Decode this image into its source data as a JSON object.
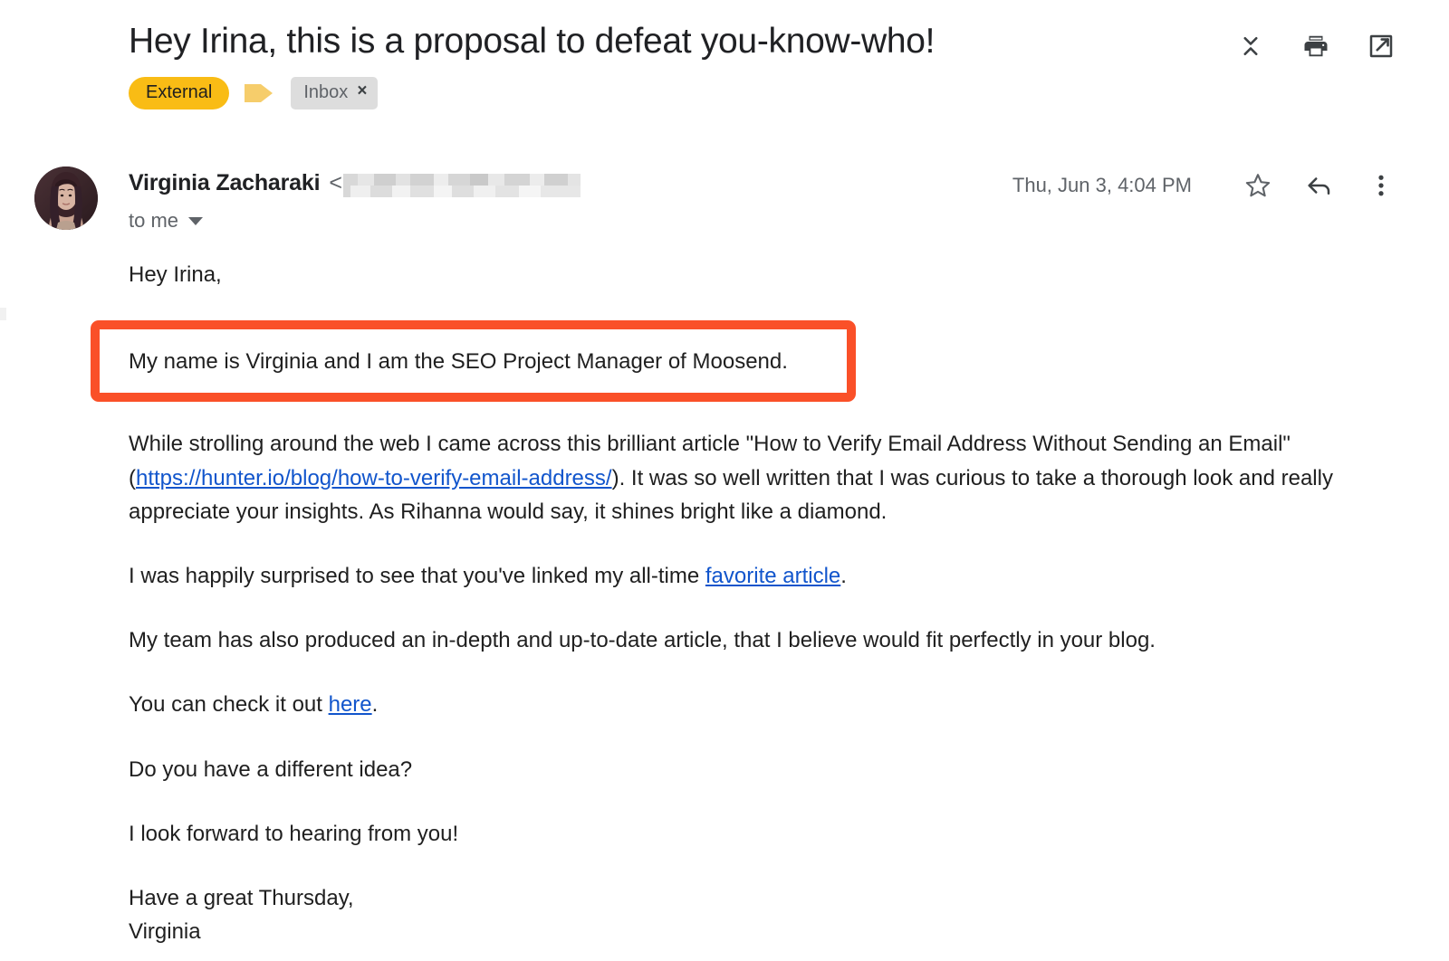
{
  "header": {
    "subject": "Hey Irina, this is a proposal to defeat you-know-who!",
    "actions": [
      {
        "name": "collapse-all-icon",
        "label": "Collapse all"
      },
      {
        "name": "print-icon",
        "label": "Print all"
      },
      {
        "name": "open-in-new-window-icon",
        "label": "Open in new window"
      }
    ]
  },
  "labels": {
    "external_label": "External",
    "inbox_label": "Inbox",
    "remove_label": "×",
    "external_color": "#f9bc15",
    "arrow_color": "#f6cd6b",
    "inbox_color": "#dddddd"
  },
  "sender": {
    "name": "Virginia Zacharaki",
    "angle_open": "<",
    "email_redacted": "",
    "recipients": "to me",
    "timestamp": "Thu, Jun 3, 4:04 PM",
    "actions": [
      {
        "name": "star-icon",
        "label": "Star"
      },
      {
        "name": "reply-icon",
        "label": "Reply"
      },
      {
        "name": "more-options-icon",
        "label": "More"
      }
    ]
  },
  "body": {
    "greeting": "Hey Irina,",
    "highlight_text": "My name is Virginia and I am the SEO Project Manager of Moosend.",
    "highlight_color": "#fa5028",
    "para_article_1": "While strolling around the web I came across this brilliant article \"How to Verify Email Address Without Sending an Email\" (",
    "article_url": "https://hunter.io/blog/how-to-verify-email-address/",
    "para_article_2": "). It was so well written that I was curious to take a thorough look and really appreciate your insights. As Rihanna would say, it shines bright like a diamond.",
    "para_favorite_1": "I was happily surprised to see that you've linked my all-time ",
    "favorite_link": "favorite article",
    "para_favorite_2": ".",
    "para_team": "My team has also produced an in-depth and up-to-date article, that I believe would fit perfectly in your blog.",
    "para_check_1": "You can check it out ",
    "here_link": "here",
    "para_check_2": ".",
    "para_idea": "Do you have a different idea?",
    "para_forward": "I look forward to hearing from you!",
    "sign_off": "Have a great Thursday,",
    "signature": "Virginia",
    "link_color": "#1155cc"
  }
}
